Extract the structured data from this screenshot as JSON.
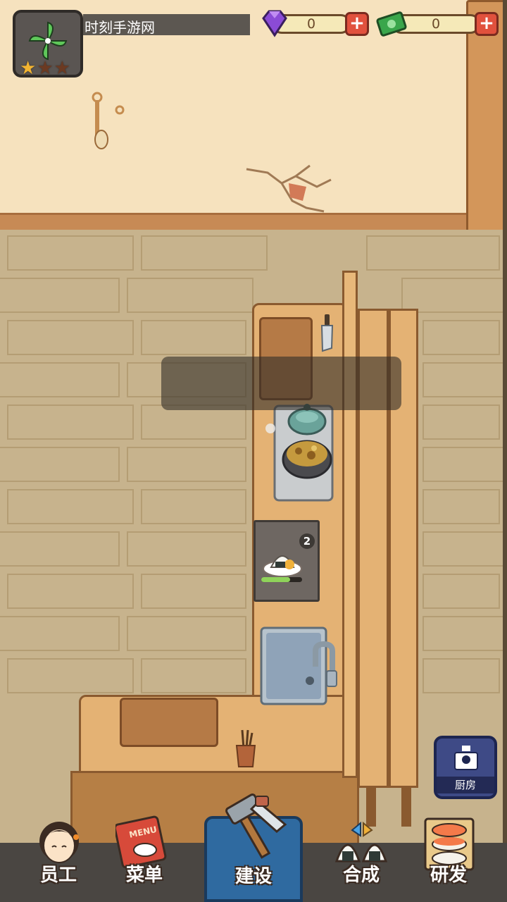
{
  "hud": {
    "site_name": "时刻手游网",
    "stars_filled": 1,
    "stars_total": 3,
    "gems": "0",
    "cash": "0"
  },
  "station": {
    "plate_count": "2",
    "progress": 0.7
  },
  "kitchen_button": {
    "label": "厨房"
  },
  "nav": {
    "staff": "员工",
    "menu": "菜单",
    "menu_icon_text": "MENU",
    "build": "建设",
    "merge": "合成",
    "research": "研发"
  },
  "colors": {
    "nav_active": "#2f6aa0",
    "gem": "#8b4bd6",
    "cash": "#3aa64b",
    "plus_button": "#e1513d"
  }
}
